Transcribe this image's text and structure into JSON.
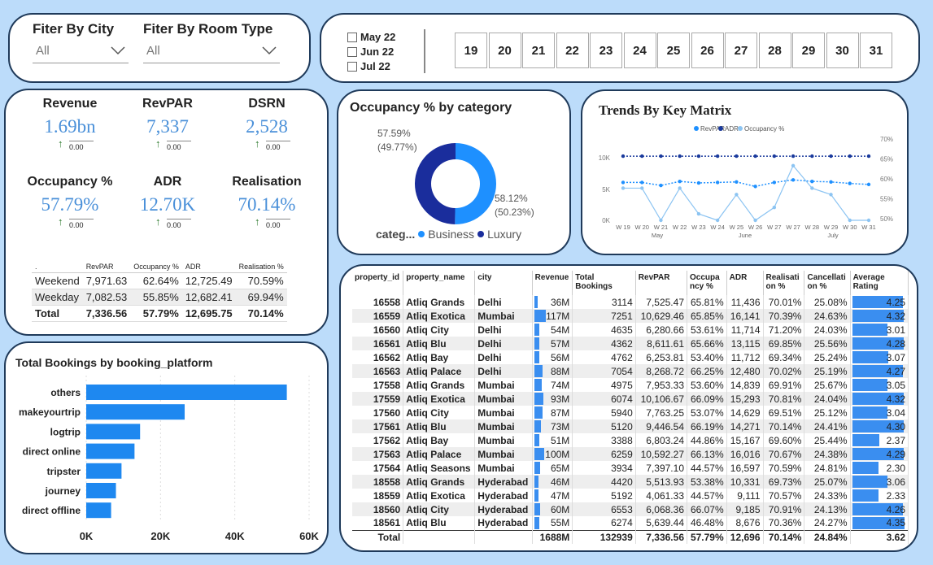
{
  "filters": {
    "city_label": "Fiter By City",
    "city_value": "All",
    "room_label": "Fiter By Room Type",
    "room_value": "All"
  },
  "date_slicer": {
    "months": [
      "May 22",
      "Jun 22",
      "Jul 22"
    ],
    "days": [
      "19",
      "20",
      "21",
      "22",
      "23",
      "24",
      "25",
      "26",
      "27",
      "28",
      "29",
      "30",
      "31"
    ]
  },
  "kpis": [
    {
      "title": "Revenue",
      "value": "1.69bn",
      "change": "0.00"
    },
    {
      "title": "RevPAR",
      "value": "7,337",
      "change": "0.00"
    },
    {
      "title": "DSRN",
      "value": "2,528",
      "change": "0.00"
    },
    {
      "title": "Occupancy %",
      "value": "57.79%",
      "change": "0.00"
    },
    {
      "title": "ADR",
      "value": "12.70K",
      "change": "0.00"
    },
    {
      "title": "Realisation",
      "value": "70.14%",
      "change": "0.00"
    }
  ],
  "daytype_table": {
    "headers": [
      ".",
      "RevPAR",
      "Occupancy %",
      "ADR",
      "Realisation %"
    ],
    "rows": [
      [
        "Weekend",
        "7,971.63",
        "62.64%",
        "12,725.49",
        "70.59%"
      ],
      [
        "Weekday",
        "7,082.53",
        "55.85%",
        "12,682.41",
        "69.94%"
      ],
      [
        "Total",
        "7,336.56",
        "57.79%",
        "12,695.75",
        "70.14%"
      ]
    ]
  },
  "occupancy_donut": {
    "title": "Occupancy % by category",
    "legend_label": "categ...",
    "business_color": "#1e90ff",
    "luxury_color": "#1a2d9c",
    "chart_data": {
      "type": "pie",
      "categories": [
        "Business",
        "Luxury"
      ],
      "values": [
        58.12,
        57.59
      ],
      "labels": [
        {
          "pct": "58.12%",
          "share": "(50.23%)"
        },
        {
          "pct": "57.59%",
          "share": "(49.77%)"
        }
      ]
    }
  },
  "trends": {
    "title": "Trends By Key Matrix",
    "colors": {
      "revpar": "#1e90ff",
      "adr": "#1a3a9c",
      "occupancy": "#8cc4f2"
    },
    "chart_data": {
      "type": "line",
      "x": [
        "W 19",
        "W 20",
        "W 21",
        "W 22",
        "W 23",
        "W 24",
        "W 25",
        "W 26",
        "W 27",
        "W 27",
        "W 28",
        "W 29",
        "W 30",
        "W 31"
      ],
      "month_labels": [
        "May",
        "June",
        "July"
      ],
      "left_ticks": [
        "10K",
        "5K",
        "0K"
      ],
      "right_ticks": [
        "70%",
        "65%",
        "60%",
        "55%",
        "50%"
      ],
      "series": [
        {
          "name": "RevPAR",
          "values": [
            7500,
            7500,
            6900,
            7700,
            7400,
            7500,
            7600,
            6700,
            7500,
            8000,
            7700,
            7600,
            7300,
            7100
          ]
        },
        {
          "name": "ADR",
          "values": [
            12700,
            12700,
            12700,
            12700,
            12700,
            12700,
            12700,
            12700,
            12700,
            12700,
            12700,
            12700,
            12700,
            12700
          ]
        },
        {
          "name": "Occupancy %",
          "values": [
            60,
            60,
            50,
            60,
            52,
            50,
            58,
            50,
            54,
            67,
            60,
            58,
            50,
            50
          ]
        }
      ]
    }
  },
  "bookings_chart": {
    "title": "Total Bookings by booking_platform",
    "bar_color": "#1e88f0",
    "chart_data": {
      "type": "bar",
      "categories": [
        "others",
        "makeyourtrip",
        "logtrip",
        "direct online",
        "tripster",
        "journey",
        "direct offline"
      ],
      "values": [
        54000,
        26500,
        14500,
        13000,
        9500,
        8000,
        6700
      ],
      "xlim": [
        0,
        60000
      ],
      "ticks": [
        "0K",
        "20K",
        "40K",
        "60K"
      ]
    }
  },
  "property_table": {
    "headers": [
      "property_id",
      "property_name",
      "city",
      "Revenue",
      "Total Bookings",
      "RevPAR",
      "Occupa ncy %",
      "ADR",
      "Realisati on %",
      "Cancellati on %",
      "Average Rating"
    ],
    "rows": [
      [
        "16558",
        "Atliq Grands",
        "Delhi",
        "36M",
        "3114",
        "7,525.47",
        "65.81%",
        "11,436",
        "70.01%",
        "25.08%",
        "4.25"
      ],
      [
        "16559",
        "Atliq Exotica",
        "Mumbai",
        "117M",
        "7251",
        "10,629.46",
        "65.85%",
        "16,141",
        "70.39%",
        "24.63%",
        "4.32"
      ],
      [
        "16560",
        "Atliq City",
        "Delhi",
        "54M",
        "4635",
        "6,280.66",
        "53.61%",
        "11,714",
        "71.20%",
        "24.03%",
        "3.01"
      ],
      [
        "16561",
        "Atliq Blu",
        "Delhi",
        "57M",
        "4362",
        "8,611.61",
        "65.66%",
        "13,115",
        "69.85%",
        "25.56%",
        "4.28"
      ],
      [
        "16562",
        "Atliq Bay",
        "Delhi",
        "56M",
        "4762",
        "6,253.81",
        "53.40%",
        "11,712",
        "69.34%",
        "25.24%",
        "3.07"
      ],
      [
        "16563",
        "Atliq Palace",
        "Delhi",
        "88M",
        "7054",
        "8,268.72",
        "66.25%",
        "12,480",
        "70.02%",
        "25.19%",
        "4.27"
      ],
      [
        "17558",
        "Atliq Grands",
        "Mumbai",
        "74M",
        "4975",
        "7,953.33",
        "53.60%",
        "14,839",
        "69.91%",
        "25.67%",
        "3.05"
      ],
      [
        "17559",
        "Atliq Exotica",
        "Mumbai",
        "93M",
        "6074",
        "10,106.67",
        "66.09%",
        "15,293",
        "70.81%",
        "24.04%",
        "4.32"
      ],
      [
        "17560",
        "Atliq City",
        "Mumbai",
        "87M",
        "5940",
        "7,763.25",
        "53.07%",
        "14,629",
        "69.51%",
        "25.12%",
        "3.04"
      ],
      [
        "17561",
        "Atliq Blu",
        "Mumbai",
        "73M",
        "5120",
        "9,446.54",
        "66.19%",
        "14,271",
        "70.14%",
        "24.41%",
        "4.30"
      ],
      [
        "17562",
        "Atliq Bay",
        "Mumbai",
        "51M",
        "3388",
        "6,803.24",
        "44.86%",
        "15,167",
        "69.60%",
        "25.44%",
        "2.37"
      ],
      [
        "17563",
        "Atliq Palace",
        "Mumbai",
        "100M",
        "6259",
        "10,592.27",
        "66.13%",
        "16,016",
        "70.67%",
        "24.38%",
        "4.29"
      ],
      [
        "17564",
        "Atliq Seasons",
        "Mumbai",
        "65M",
        "3934",
        "7,397.10",
        "44.57%",
        "16,597",
        "70.59%",
        "24.81%",
        "2.30"
      ],
      [
        "18558",
        "Atliq Grands",
        "Hyderabad",
        "46M",
        "4420",
        "5,513.93",
        "53.38%",
        "10,331",
        "69.73%",
        "25.07%",
        "3.06"
      ],
      [
        "18559",
        "Atliq Exotica",
        "Hyderabad",
        "47M",
        "5192",
        "4,061.33",
        "44.57%",
        "9,111",
        "70.57%",
        "24.33%",
        "2.33"
      ],
      [
        "18560",
        "Atliq City",
        "Hyderabad",
        "60M",
        "6553",
        "6,068.36",
        "66.07%",
        "9,185",
        "70.91%",
        "24.13%",
        "4.26"
      ],
      [
        "18561",
        "Atliq Blu",
        "Hyderabad",
        "55M",
        "6274",
        "5,639.44",
        "46.48%",
        "8,676",
        "70.36%",
        "24.27%",
        "4.35"
      ]
    ],
    "total": [
      "Total",
      "",
      "",
      "1688M",
      "132939",
      "7,336.56",
      "57.79%",
      "12,696",
      "70.14%",
      "24.84%",
      "3.62"
    ],
    "revenue_max": 117,
    "rating_max": 4.5
  }
}
